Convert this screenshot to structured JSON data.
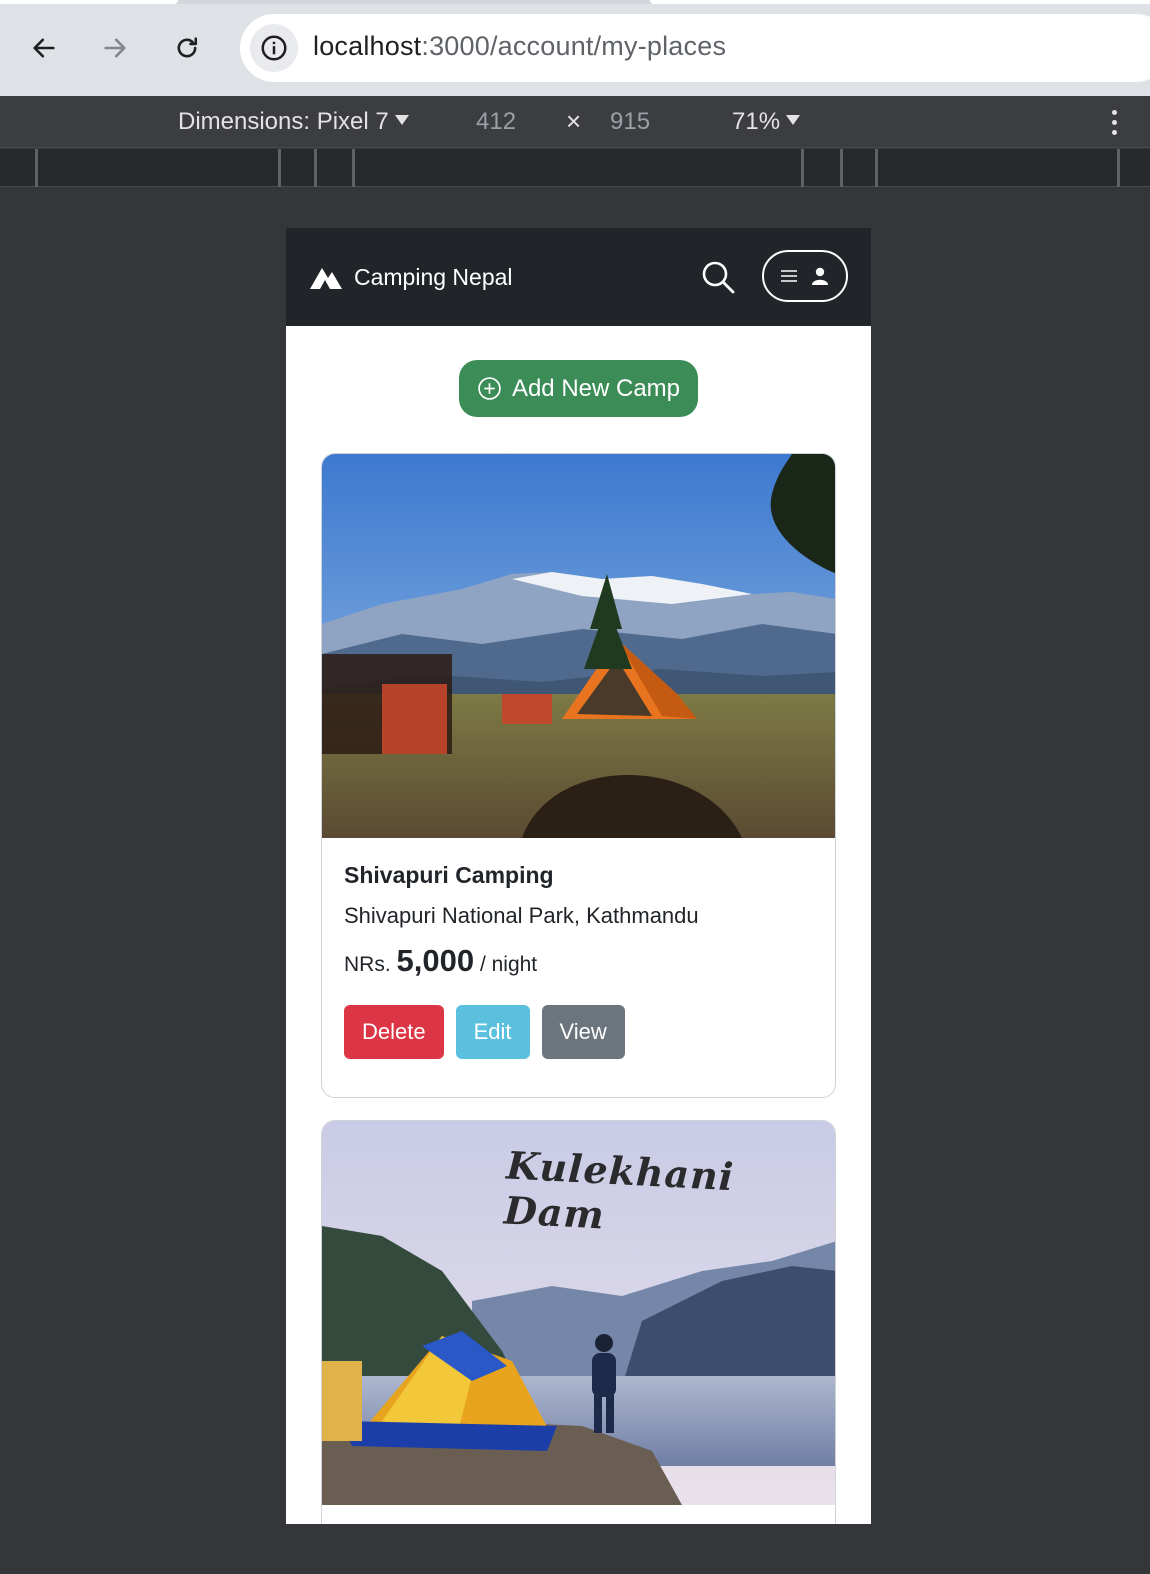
{
  "browser": {
    "url_host": "localhost",
    "url_path": ":3000/account/my-places"
  },
  "devtools": {
    "dimensions_label": "Dimensions: Pixel 7",
    "width": "412",
    "times": "×",
    "height": "915",
    "zoom": "71%"
  },
  "app": {
    "brand": "Camping Nepal",
    "add_button": "Add New Camp",
    "colors": {
      "navbar": "#212529",
      "success": "#3c8c57",
      "danger": "#dc3545",
      "info": "#5bc0de",
      "secondary": "#6c757d"
    }
  },
  "camps": [
    {
      "title": "Shivapuri Camping",
      "location": "Shivapuri National Park, Kathmandu",
      "currency": "NRs.",
      "price": "5,000",
      "unit": "/ night",
      "buttons": {
        "delete": "Delete",
        "edit": "Edit",
        "view": "View"
      }
    },
    {
      "image_text": "Kulekhani Dam"
    }
  ],
  "icons": [
    "back-arrow-icon",
    "forward-arrow-icon",
    "reload-icon",
    "info-icon",
    "tent-logo-icon",
    "search-icon",
    "menu-icon",
    "user-icon",
    "plus-circle-icon",
    "kebab-icon"
  ]
}
